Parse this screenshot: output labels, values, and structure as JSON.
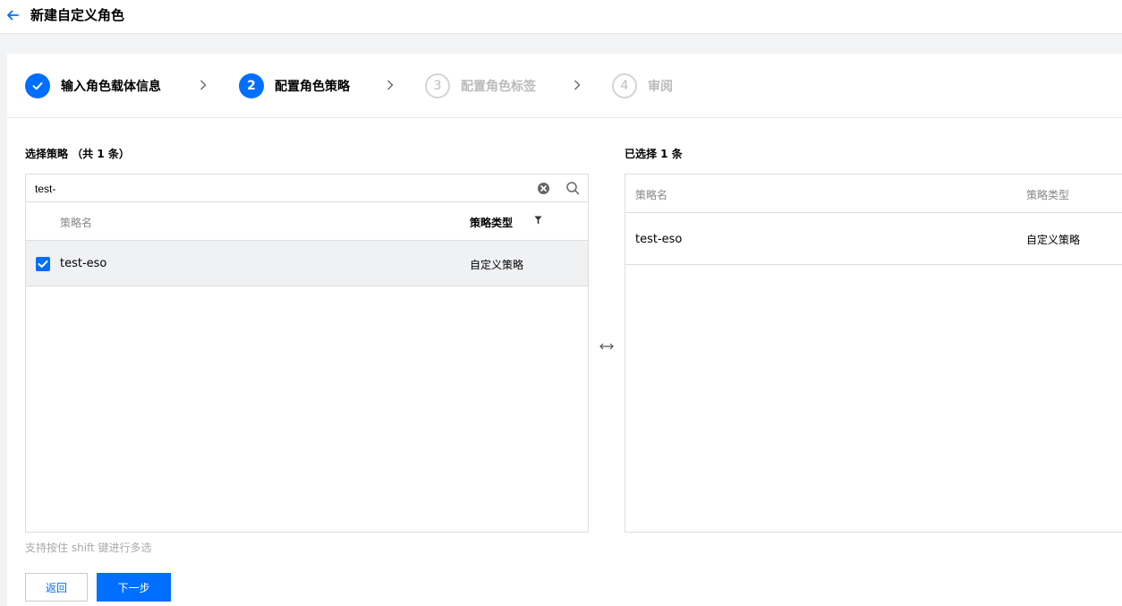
{
  "header": {
    "title": "新建自定义角色"
  },
  "steps": [
    {
      "number": "",
      "label": "输入角色载体信息",
      "state": "done"
    },
    {
      "number": "2",
      "label": "配置角色策略",
      "state": "active"
    },
    {
      "number": "3",
      "label": "配置角色标签",
      "state": "todo"
    },
    {
      "number": "4",
      "label": "审阅",
      "state": "todo"
    }
  ],
  "left": {
    "title": "选择策略 （共 1 条）",
    "search_value": "test-",
    "columns": {
      "name": "策略名",
      "type": "策略类型"
    },
    "rows": [
      {
        "name": "test-eso",
        "type": "自定义策略",
        "checked": true
      }
    ],
    "hint": "支持按住 shift 键进行多选"
  },
  "right": {
    "title": "已选择 1 条",
    "columns": {
      "name": "策略名",
      "type": "策略类型"
    },
    "rows": [
      {
        "name": "test-eso",
        "type": "自定义策略"
      }
    ]
  },
  "buttons": {
    "back": "返回",
    "next": "下一步"
  },
  "colors": {
    "primary": "#006eff",
    "disabled": "#bbbbbb",
    "border": "#dddddd"
  }
}
